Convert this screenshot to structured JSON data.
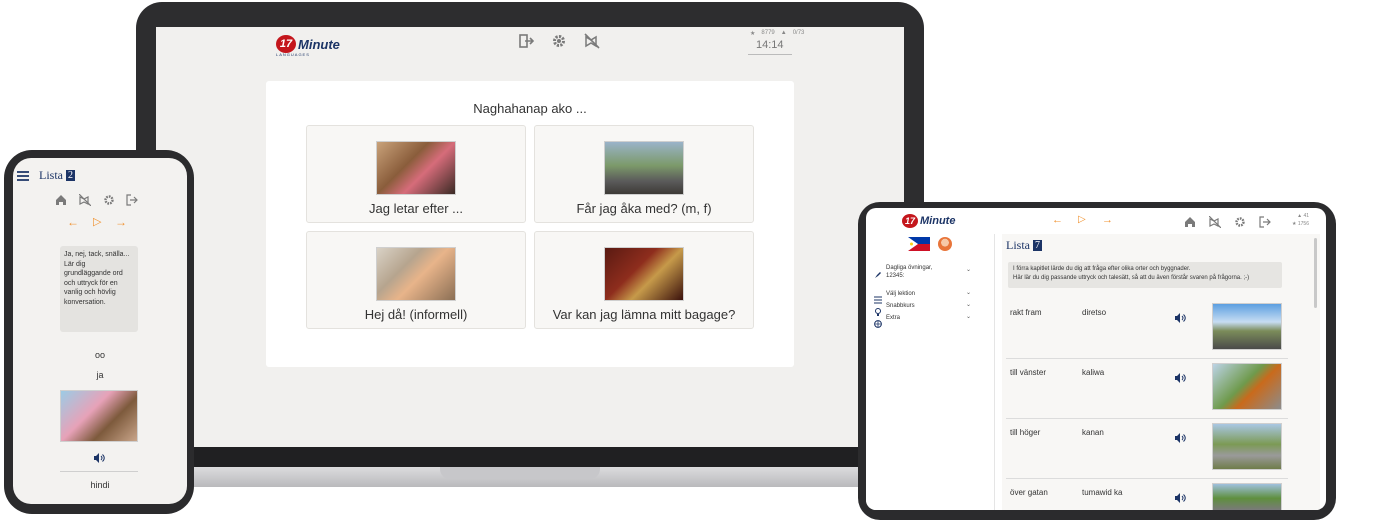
{
  "brand": {
    "badge": "17",
    "name": "Minute",
    "sub": "LANGUAGES"
  },
  "colors": {
    "accent": "#f0912e",
    "navy": "#1c3466",
    "brand_red": "#c4161c"
  },
  "laptop": {
    "stats": {
      "stars": "8779",
      "mortar": "0/73"
    },
    "timer": "14:14",
    "nav_icons": [
      "exit-icon",
      "gear-icon",
      "no-flashcards-icon"
    ],
    "question": "Naghahanap ako ...",
    "options": [
      {
        "label": "Jag letar efter ...",
        "image": "group-looking-photo"
      },
      {
        "label": "Får jag åka med? (m, f)",
        "image": "hitchhiker-photo"
      },
      {
        "label": "Hej då! (informell)",
        "image": "couple-waving-photo"
      },
      {
        "label": "Var kan jag lämna mitt bagage?",
        "image": "luggage-room-photo"
      }
    ]
  },
  "phone": {
    "title": "Lista",
    "list_number": "2",
    "intro": "Ja, nej, tack, snälla...\nLär dig grundläggande ord och uttryck för en vanlig och hövlig konversation.",
    "word_foreign": "oo",
    "word_native": "ja",
    "next_word": "hindi"
  },
  "tablet": {
    "stats": {
      "mortar": "41",
      "stars": "1756"
    },
    "sidebar": {
      "items": [
        {
          "label": "Dagliga övningar, 12345:",
          "icon": "rocket-icon"
        },
        {
          "label": "Välj lektion",
          "icon": "list-icon"
        },
        {
          "label": "Snabbkurs",
          "icon": "bulb-icon"
        },
        {
          "label": "Extra",
          "icon": "globe-icon"
        }
      ]
    },
    "title": "Lista",
    "list_number": "7",
    "intro_line1": "I förra kapitlet lärde du dig att fråga efter olika orter och byggnader.",
    "intro_line2": "Här lär du dig passande uttryck och talesätt, så att du även förstår svaren på frågorna. ;-)",
    "rows": [
      {
        "native": "rakt fram",
        "foreign": "diretso",
        "image": "straight-road-photo"
      },
      {
        "native": "till vänster",
        "foreign": "kaliwa",
        "image": "left-sign-photo"
      },
      {
        "native": "till höger",
        "foreign": "kanan",
        "image": "right-road-photo"
      },
      {
        "native": "över gatan",
        "foreign": "tumawid ka",
        "image": "street-photo"
      }
    ]
  }
}
